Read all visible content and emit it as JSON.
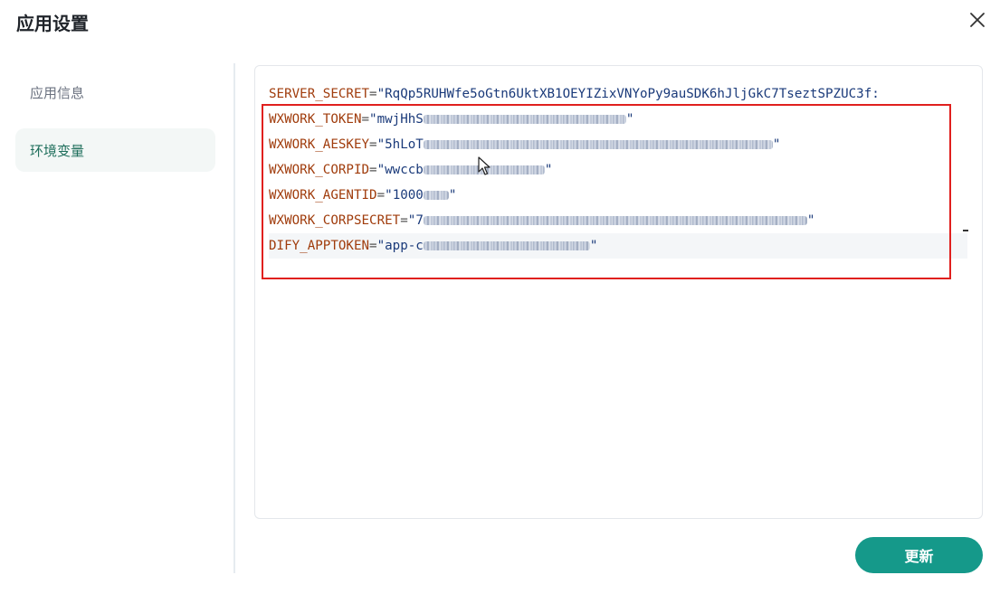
{
  "dialog": {
    "title": "应用设置",
    "close_icon": "close-icon"
  },
  "sidebar": {
    "items": [
      {
        "label": "应用信息",
        "active": false
      },
      {
        "label": "环境变量",
        "active": true
      }
    ]
  },
  "editor": {
    "lines": [
      {
        "key": "SERVER_SECRET",
        "value_visible": "RqQp5RUHWfe5oGtn6UktXB1OEYIZixVNYoPy9auSDK6hJljGkC7TseztSPZUC3f:"
      },
      {
        "key": "WXWORK_TOKEN",
        "value_visible": "mwjHhS"
      },
      {
        "key": "WXWORK_AESKEY",
        "value_visible": "5hLoT"
      },
      {
        "key": "WXWORK_CORPID",
        "value_visible": "wwccb"
      },
      {
        "key": "WXWORK_AGENTID",
        "value_visible": "1000"
      },
      {
        "key": "WXWORK_CORPSECRET",
        "value_visible": "7"
      },
      {
        "key": "DIFY_APPTOKEN",
        "value_visible": "app-c"
      }
    ]
  },
  "footer": {
    "update_label": "更新"
  },
  "colors": {
    "accent": "#15998a",
    "highlight_box": "#e0201e",
    "key_text": "#a03c0c",
    "value_text": "#1a3a7a"
  }
}
